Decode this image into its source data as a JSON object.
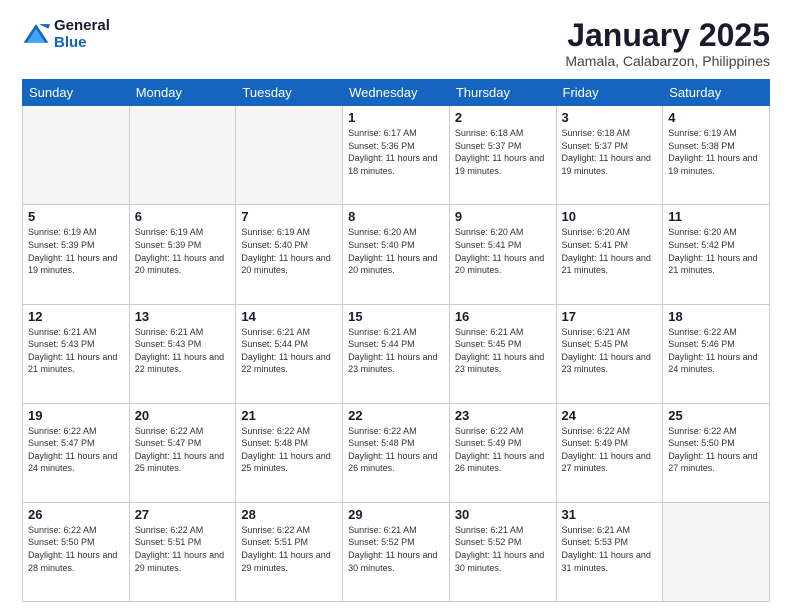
{
  "logo": {
    "general": "General",
    "blue": "Blue"
  },
  "title": "January 2025",
  "subtitle": "Mamala, Calabarzon, Philippines",
  "days_of_week": [
    "Sunday",
    "Monday",
    "Tuesday",
    "Wednesday",
    "Thursday",
    "Friday",
    "Saturday"
  ],
  "weeks": [
    [
      {
        "day": "",
        "info": ""
      },
      {
        "day": "",
        "info": ""
      },
      {
        "day": "",
        "info": ""
      },
      {
        "day": "1",
        "info": "Sunrise: 6:17 AM\nSunset: 5:36 PM\nDaylight: 11 hours and 18 minutes."
      },
      {
        "day": "2",
        "info": "Sunrise: 6:18 AM\nSunset: 5:37 PM\nDaylight: 11 hours and 19 minutes."
      },
      {
        "day": "3",
        "info": "Sunrise: 6:18 AM\nSunset: 5:37 PM\nDaylight: 11 hours and 19 minutes."
      },
      {
        "day": "4",
        "info": "Sunrise: 6:19 AM\nSunset: 5:38 PM\nDaylight: 11 hours and 19 minutes."
      }
    ],
    [
      {
        "day": "5",
        "info": "Sunrise: 6:19 AM\nSunset: 5:39 PM\nDaylight: 11 hours and 19 minutes."
      },
      {
        "day": "6",
        "info": "Sunrise: 6:19 AM\nSunset: 5:39 PM\nDaylight: 11 hours and 20 minutes."
      },
      {
        "day": "7",
        "info": "Sunrise: 6:19 AM\nSunset: 5:40 PM\nDaylight: 11 hours and 20 minutes."
      },
      {
        "day": "8",
        "info": "Sunrise: 6:20 AM\nSunset: 5:40 PM\nDaylight: 11 hours and 20 minutes."
      },
      {
        "day": "9",
        "info": "Sunrise: 6:20 AM\nSunset: 5:41 PM\nDaylight: 11 hours and 20 minutes."
      },
      {
        "day": "10",
        "info": "Sunrise: 6:20 AM\nSunset: 5:41 PM\nDaylight: 11 hours and 21 minutes."
      },
      {
        "day": "11",
        "info": "Sunrise: 6:20 AM\nSunset: 5:42 PM\nDaylight: 11 hours and 21 minutes."
      }
    ],
    [
      {
        "day": "12",
        "info": "Sunrise: 6:21 AM\nSunset: 5:43 PM\nDaylight: 11 hours and 21 minutes."
      },
      {
        "day": "13",
        "info": "Sunrise: 6:21 AM\nSunset: 5:43 PM\nDaylight: 11 hours and 22 minutes."
      },
      {
        "day": "14",
        "info": "Sunrise: 6:21 AM\nSunset: 5:44 PM\nDaylight: 11 hours and 22 minutes."
      },
      {
        "day": "15",
        "info": "Sunrise: 6:21 AM\nSunset: 5:44 PM\nDaylight: 11 hours and 23 minutes."
      },
      {
        "day": "16",
        "info": "Sunrise: 6:21 AM\nSunset: 5:45 PM\nDaylight: 11 hours and 23 minutes."
      },
      {
        "day": "17",
        "info": "Sunrise: 6:21 AM\nSunset: 5:45 PM\nDaylight: 11 hours and 23 minutes."
      },
      {
        "day": "18",
        "info": "Sunrise: 6:22 AM\nSunset: 5:46 PM\nDaylight: 11 hours and 24 minutes."
      }
    ],
    [
      {
        "day": "19",
        "info": "Sunrise: 6:22 AM\nSunset: 5:47 PM\nDaylight: 11 hours and 24 minutes."
      },
      {
        "day": "20",
        "info": "Sunrise: 6:22 AM\nSunset: 5:47 PM\nDaylight: 11 hours and 25 minutes."
      },
      {
        "day": "21",
        "info": "Sunrise: 6:22 AM\nSunset: 5:48 PM\nDaylight: 11 hours and 25 minutes."
      },
      {
        "day": "22",
        "info": "Sunrise: 6:22 AM\nSunset: 5:48 PM\nDaylight: 11 hours and 26 minutes."
      },
      {
        "day": "23",
        "info": "Sunrise: 6:22 AM\nSunset: 5:49 PM\nDaylight: 11 hours and 26 minutes."
      },
      {
        "day": "24",
        "info": "Sunrise: 6:22 AM\nSunset: 5:49 PM\nDaylight: 11 hours and 27 minutes."
      },
      {
        "day": "25",
        "info": "Sunrise: 6:22 AM\nSunset: 5:50 PM\nDaylight: 11 hours and 27 minutes."
      }
    ],
    [
      {
        "day": "26",
        "info": "Sunrise: 6:22 AM\nSunset: 5:50 PM\nDaylight: 11 hours and 28 minutes."
      },
      {
        "day": "27",
        "info": "Sunrise: 6:22 AM\nSunset: 5:51 PM\nDaylight: 11 hours and 29 minutes."
      },
      {
        "day": "28",
        "info": "Sunrise: 6:22 AM\nSunset: 5:51 PM\nDaylight: 11 hours and 29 minutes."
      },
      {
        "day": "29",
        "info": "Sunrise: 6:21 AM\nSunset: 5:52 PM\nDaylight: 11 hours and 30 minutes."
      },
      {
        "day": "30",
        "info": "Sunrise: 6:21 AM\nSunset: 5:52 PM\nDaylight: 11 hours and 30 minutes."
      },
      {
        "day": "31",
        "info": "Sunrise: 6:21 AM\nSunset: 5:53 PM\nDaylight: 11 hours and 31 minutes."
      },
      {
        "day": "",
        "info": ""
      }
    ]
  ]
}
